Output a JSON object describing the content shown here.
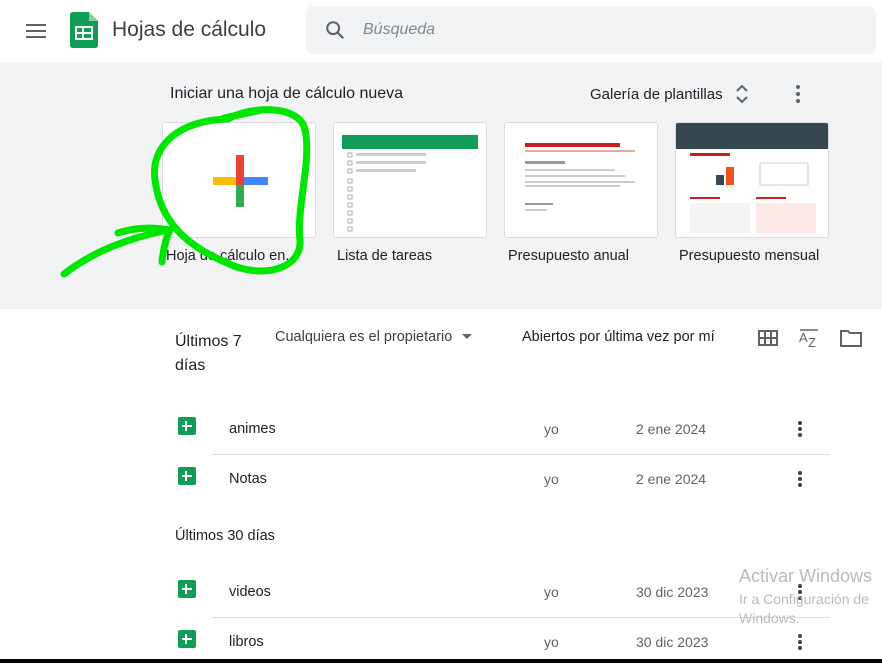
{
  "header": {
    "app_title": "Hojas de cálculo",
    "search_placeholder": "Búsqueda"
  },
  "templates": {
    "heading": "Iniciar una hoja de cálculo nueva",
    "gallery_label": "Galería de plantillas",
    "cards": [
      {
        "label": "Hoja de cálculo en..."
      },
      {
        "label": "Lista de tareas"
      },
      {
        "label": "Presupuesto anual"
      },
      {
        "label": "Presupuesto mensual"
      }
    ]
  },
  "list": {
    "period_7": "Últimos 7 días",
    "owner_filter": "Cualquiera es el propietario",
    "sort_label": "Abiertos por última vez por mí",
    "period_30": "Últimos 30 días",
    "files_7": [
      {
        "name": "animes",
        "owner": "yo",
        "date": "2 ene 2024"
      },
      {
        "name": "Notas",
        "owner": "yo",
        "date": "2 ene 2024"
      }
    ],
    "files_30": [
      {
        "name": "videos",
        "owner": "yo",
        "date": "30 dic 2023"
      },
      {
        "name": "libros",
        "owner": "yo",
        "date": "30 dic 2023"
      }
    ]
  },
  "watermark": {
    "title": "Activar Windows",
    "line1": "Ir a Configuración de",
    "line2": "Windows."
  },
  "colors": {
    "sheets_green": "#0f9d58",
    "band_bg": "#f1f3f4",
    "annotation_green": "#00e600"
  }
}
